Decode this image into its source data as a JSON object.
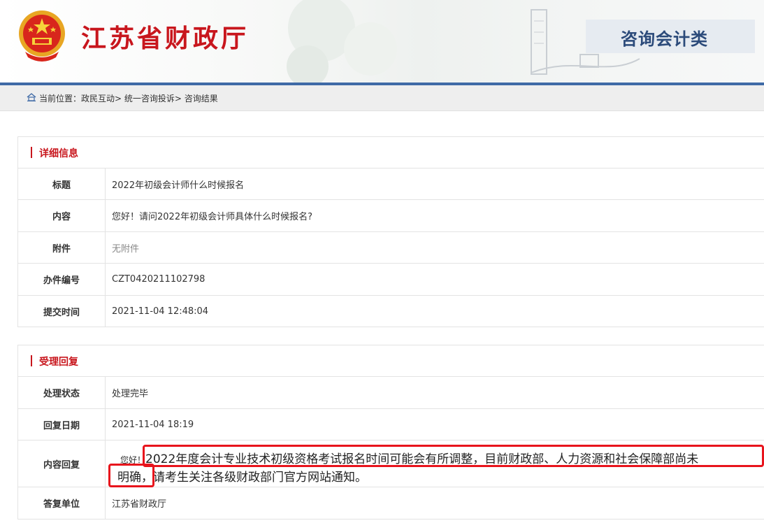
{
  "header": {
    "site_title": "江苏省财政厅",
    "category": "咨询会计类"
  },
  "breadcrumb": {
    "text": "当前位置：政民互动> 统一咨询投诉> 咨询结果"
  },
  "detail": {
    "title": "详细信息",
    "rows": [
      {
        "label": "标题",
        "value": "2022年初级会计师什么时候报名"
      },
      {
        "label": "内容",
        "value": "您好！请问2022年初级会计师具体什么时候报名?"
      },
      {
        "label": "附件",
        "value": "无附件"
      },
      {
        "label": "办件编号",
        "value": "CZT0420211102798"
      },
      {
        "label": "提交时间",
        "value": "2021-11-04 12:48:04"
      }
    ]
  },
  "reply": {
    "title": "受理回复",
    "status_label": "处理状态",
    "status_value": "处理完毕",
    "date_label": "回复日期",
    "date_value": "2021-11-04 18:19",
    "content_label": "内容回复",
    "greeting": "您好！",
    "content_line1": "2022年度会计专业技术初级资格考试报名时间可能会有所调整，目前财政部、人力资源和社会保障部尚未",
    "content_line2": "明确，请考生关注各级财政部门官方网站通知。",
    "unit_label": "答复单位",
    "unit_value": "江苏省财政厅"
  },
  "colors": {
    "brand_red": "#c8161d",
    "header_blue": "#3f6aa6",
    "highlight_red": "#e8141c"
  }
}
